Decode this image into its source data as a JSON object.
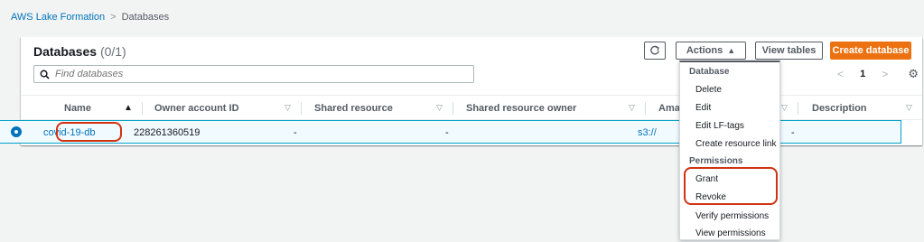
{
  "breadcrumb": {
    "root": "AWS Lake Formation",
    "separator": ">",
    "current": "Databases"
  },
  "panel": {
    "title": "Databases",
    "count": "(0/1)",
    "search_placeholder": "Find databases"
  },
  "toolbar": {
    "refresh_icon": "refresh-icon",
    "actions_label": "Actions",
    "actions_caret": "▲",
    "view_tables_label": "View tables",
    "create_database_label": "Create database"
  },
  "pagination": {
    "prev": "<",
    "page": "1",
    "next": ">",
    "settings_icon": "⚙"
  },
  "table": {
    "columns": [
      "Name",
      "Owner account ID",
      "Shared resource",
      "Shared resource owner",
      "Ama",
      "Description"
    ],
    "sort_active": "▲",
    "sort_inactive": "▽",
    "rows": [
      {
        "name": "covid-19-db",
        "owner_account_id": "228261360519",
        "shared_resource": "-",
        "shared_resource_owner": "-",
        "location": "s3://",
        "description": "-"
      }
    ]
  },
  "actions_menu": {
    "database_group": "Database",
    "database_items": [
      "Delete",
      "Edit",
      "Edit LF-tags",
      "Create resource link"
    ],
    "permissions_group": "Permissions",
    "permissions_items": [
      "Grant",
      "Revoke",
      "Verify permissions",
      "View permissions"
    ]
  },
  "colors": {
    "link": "#0073bb",
    "primary": "#ec7211",
    "highlight": "#d13212",
    "selected_row": "#f1faff"
  }
}
